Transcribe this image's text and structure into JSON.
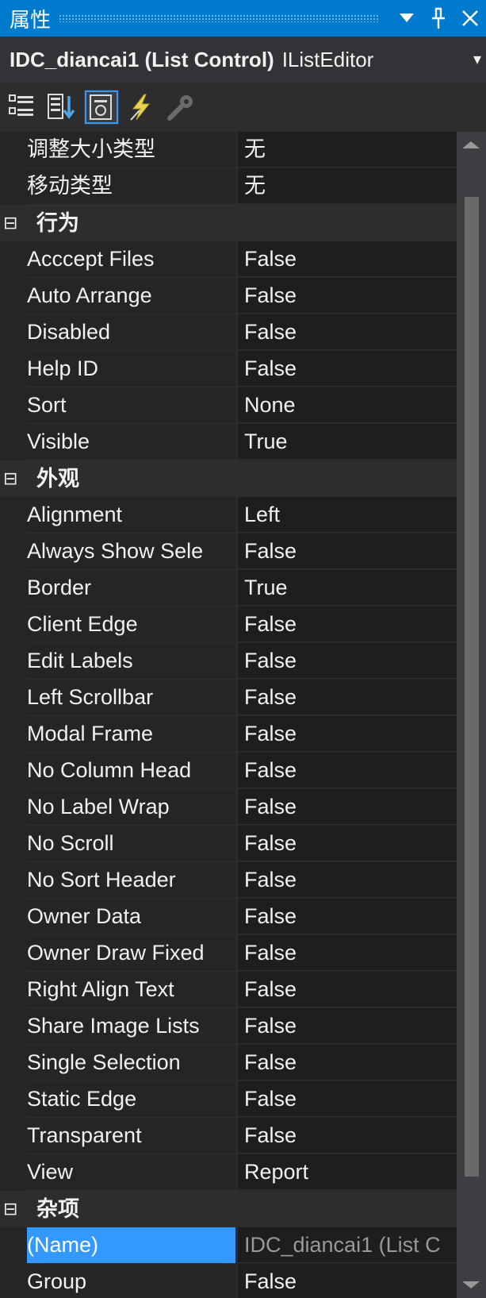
{
  "window": {
    "title": "属性",
    "buttons": [
      "▼",
      "ᛘ",
      "✕"
    ]
  },
  "object": {
    "name": "IDC_diancai1 (List Control)",
    "type": "IListEditor",
    "dropdown": "▾"
  },
  "toolbar": {
    "tools": [
      "categorized-icon",
      "alphabetical-icon",
      "properties-icon",
      "events-icon",
      "property-pages-icon"
    ]
  },
  "colors": {
    "accent": "#007acc",
    "selection": "#3399ff",
    "background": "#252526"
  },
  "grid": {
    "toggle": "⊟",
    "partial_rows": [
      {
        "name": "调整大小类型",
        "value": "无"
      },
      {
        "name": "移动类型",
        "value": "无"
      }
    ],
    "cat_behavior": {
      "name": "行为",
      "rows": [
        {
          "name": "Acccept Files",
          "value": "False"
        },
        {
          "name": "Auto Arrange",
          "value": "False"
        },
        {
          "name": "Disabled",
          "value": "False"
        },
        {
          "name": "Help ID",
          "value": "False"
        },
        {
          "name": "Sort",
          "value": "None"
        },
        {
          "name": "Visible",
          "value": "True"
        }
      ]
    },
    "cat_appearance": {
      "name": "外观",
      "rows": [
        {
          "name": "Alignment",
          "value": "Left"
        },
        {
          "name": "Always Show Sele",
          "value": "False"
        },
        {
          "name": "Border",
          "value": "True"
        },
        {
          "name": "Client Edge",
          "value": "False"
        },
        {
          "name": "Edit Labels",
          "value": "False"
        },
        {
          "name": "Left Scrollbar",
          "value": "False"
        },
        {
          "name": "Modal Frame",
          "value": "False"
        },
        {
          "name": "No Column Head",
          "value": "False"
        },
        {
          "name": "No Label Wrap",
          "value": "False"
        },
        {
          "name": "No Scroll",
          "value": "False"
        },
        {
          "name": "No Sort Header",
          "value": "False"
        },
        {
          "name": "Owner Data",
          "value": "False"
        },
        {
          "name": "Owner Draw Fixed",
          "value": "False"
        },
        {
          "name": "Right Align Text",
          "value": "False"
        },
        {
          "name": "Share Image Lists",
          "value": "False"
        },
        {
          "name": "Single Selection",
          "value": "False"
        },
        {
          "name": "Static Edge",
          "value": "False"
        },
        {
          "name": "Transparent",
          "value": "False"
        },
        {
          "name": "View",
          "value": "Report"
        }
      ]
    },
    "cat_misc": {
      "name": "杂项",
      "rows": [
        {
          "name": "(Name)",
          "value": "IDC_diancai1 (List C"
        },
        {
          "name": "Group",
          "value": "False"
        }
      ]
    }
  }
}
